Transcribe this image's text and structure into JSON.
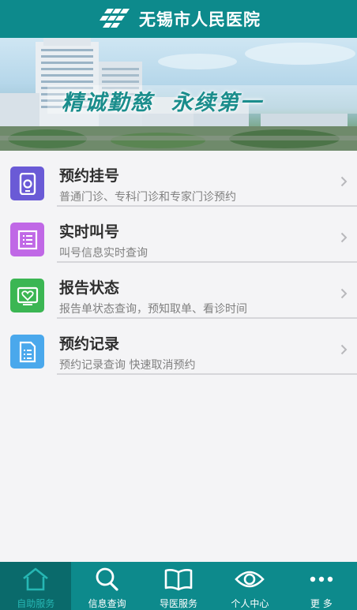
{
  "header": {
    "title": "无锡市人民医院",
    "logo_icon": "hospital-cross-logo-icon"
  },
  "banner": {
    "slogan": "精诚勤慈  永续第一"
  },
  "menu": {
    "items": [
      {
        "title": "预约挂号",
        "subtitle": "普通门诊、专科门诊和专家门诊预约",
        "icon": "phone-appointment-icon",
        "color": "#6a5ad6"
      },
      {
        "title": "实时叫号",
        "subtitle": "叫号信息实时查询",
        "icon": "queue-list-icon",
        "color": "#c068e6"
      },
      {
        "title": "报告状态",
        "subtitle": "报告单状态查询，预知取单、看诊时间",
        "icon": "heart-report-icon",
        "color": "#3bb653"
      },
      {
        "title": "预约记录",
        "subtitle": "预约记录查询 快速取消预约",
        "icon": "document-record-icon",
        "color": "#4aa8ec"
      }
    ]
  },
  "tabbar": {
    "tabs": [
      {
        "label": "自助服务",
        "icon": "home-icon",
        "active": true
      },
      {
        "label": "信息查询",
        "icon": "search-icon",
        "active": false
      },
      {
        "label": "导医服务",
        "icon": "book-icon",
        "active": false
      },
      {
        "label": "个人中心",
        "icon": "eye-icon",
        "active": false
      },
      {
        "label": "更 多",
        "icon": "more-dots-icon",
        "active": false
      }
    ]
  },
  "colors": {
    "brand": "#0d8a8c",
    "brand_dark": "#0a6a6b",
    "active_label": "#26b7b4",
    "background": "#f4f4f6"
  }
}
